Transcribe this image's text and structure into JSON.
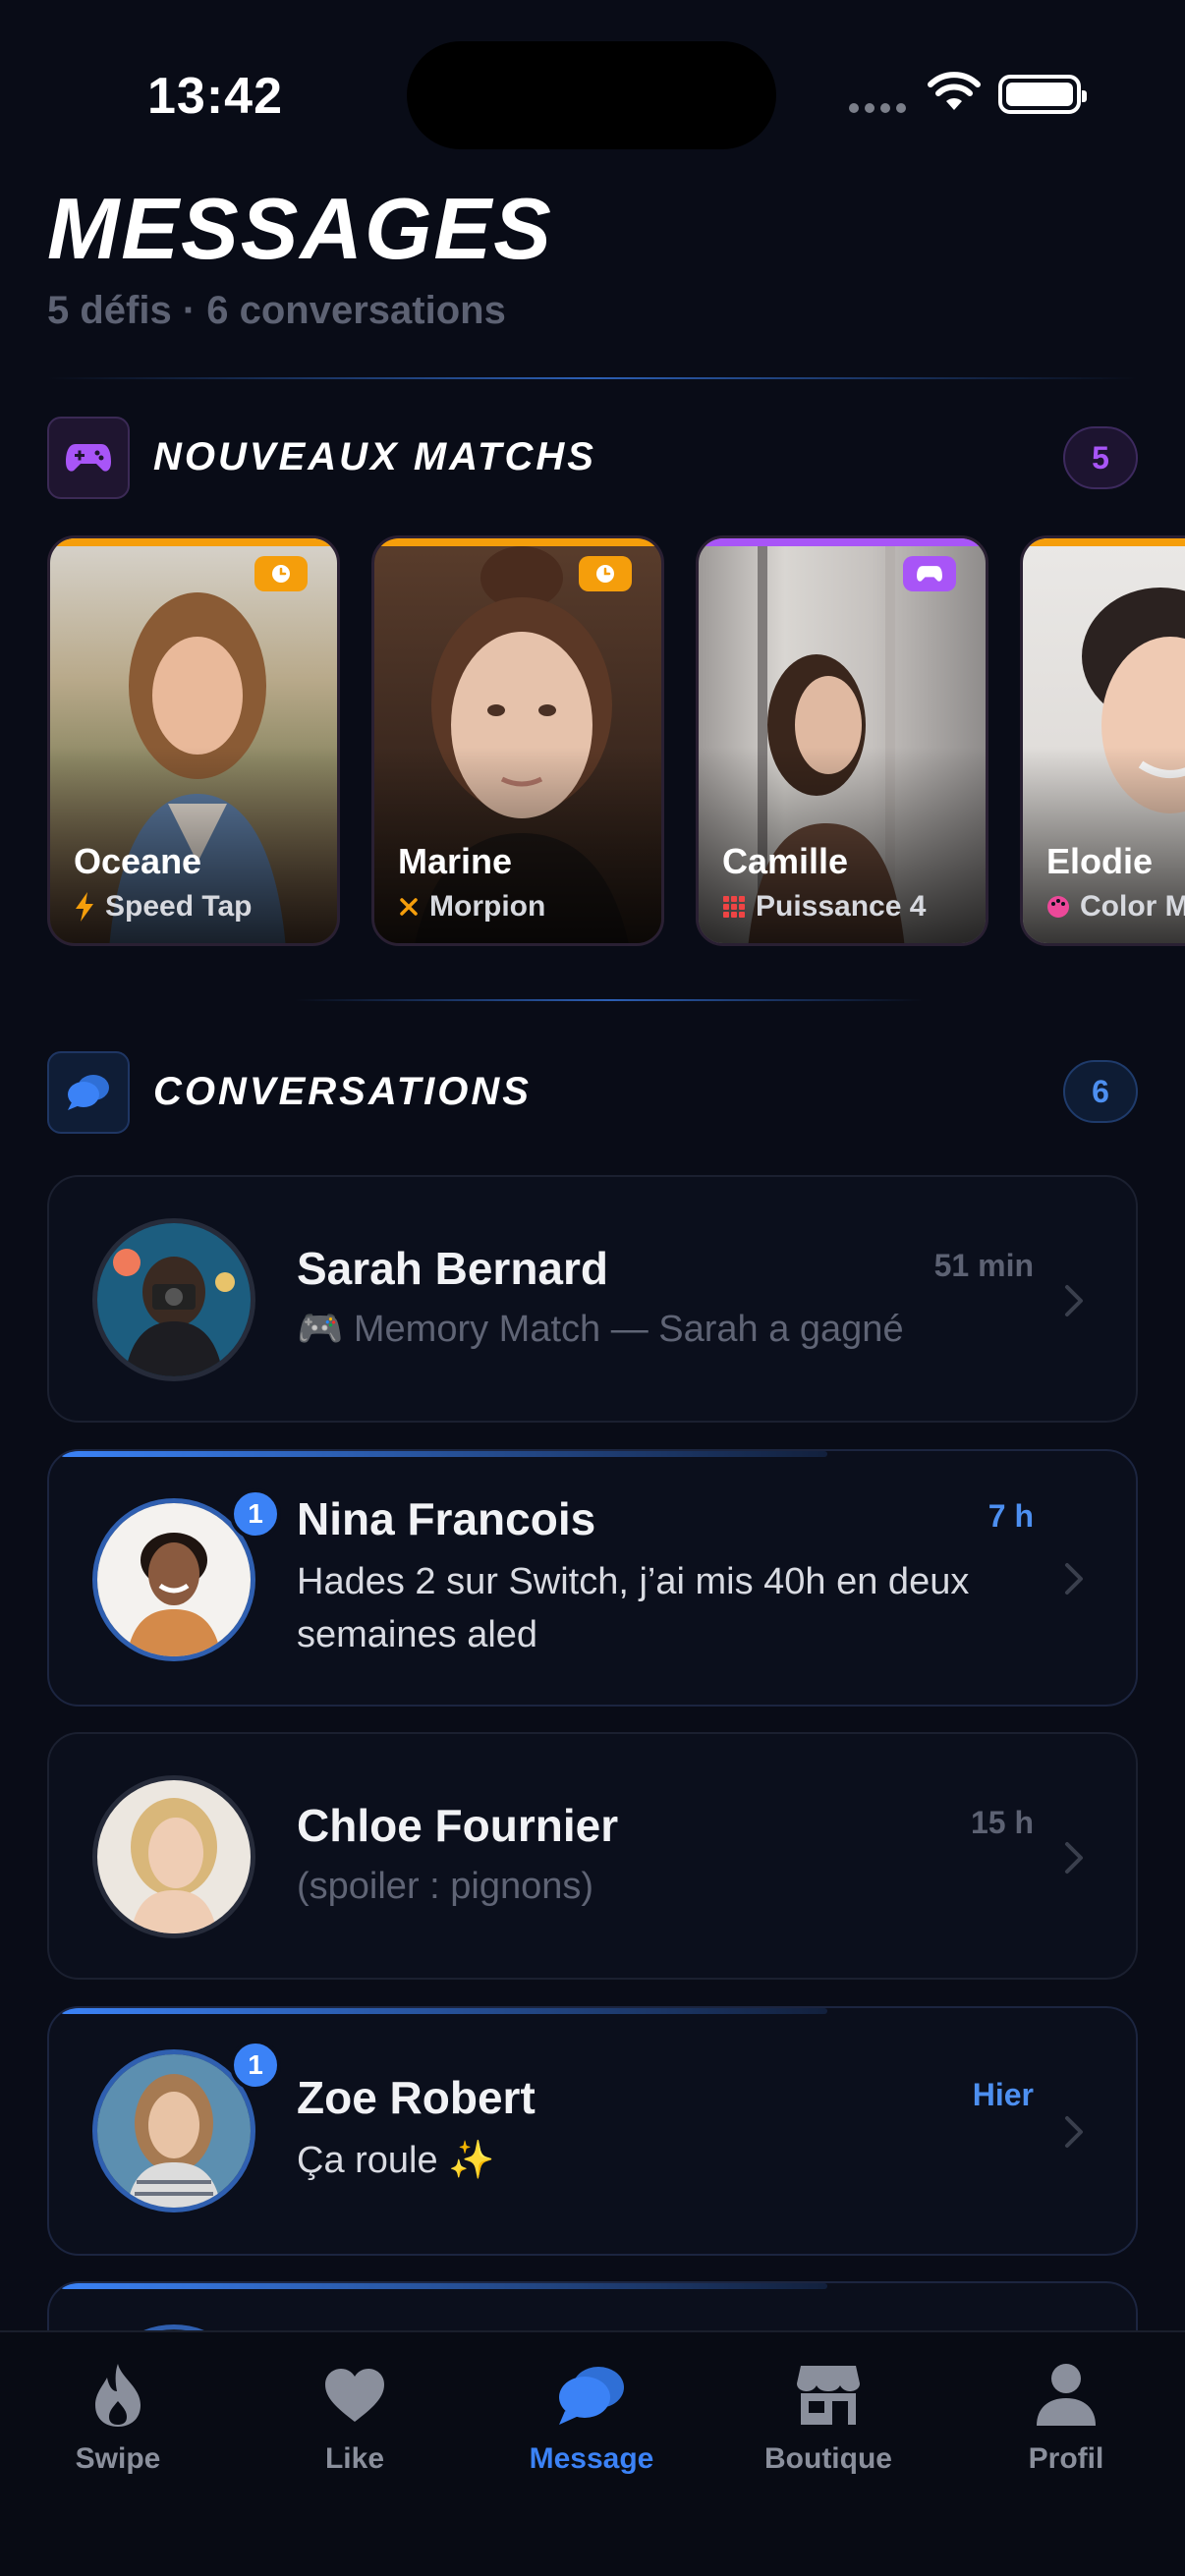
{
  "status_bar": {
    "time": "13:42"
  },
  "header": {
    "title": "MESSAGES",
    "subtitle": "5 défis · 6 conversations"
  },
  "new_matches": {
    "title": "NOUVEAUX MATCHS",
    "count": "5",
    "icon": "gamepad-icon",
    "accent_color": "#a855f7",
    "items": [
      {
        "name": "Oceane",
        "game": "Speed Tap",
        "game_icon": "lightning-icon",
        "badge_icon": "clock-icon",
        "badge_color": "#f59e0b"
      },
      {
        "name": "Marine",
        "game": "Morpion",
        "game_icon": "x-mark-icon",
        "badge_icon": "clock-icon",
        "badge_color": "#f59e0b"
      },
      {
        "name": "Camille",
        "game": "Puissance 4",
        "game_icon": "grid-dots-icon",
        "badge_icon": "gamepad-icon",
        "badge_color": "#a855f7"
      },
      {
        "name": "Elodie",
        "game": "Color M",
        "game_icon": "palette-icon",
        "badge_icon": "",
        "badge_color": ""
      }
    ]
  },
  "conversations": {
    "title": "CONVERSATIONS",
    "count": "6",
    "icon": "chat-bubbles-icon",
    "accent_color": "#3b82f6",
    "items": [
      {
        "name": "Sarah Bernard",
        "time": "51 min",
        "preview": "🎮 Memory Match — Sarah a gagné",
        "unread": "",
        "is_unread": false
      },
      {
        "name": "Nina Francois",
        "time": "7 h",
        "preview": "Hades 2 sur Switch, j’ai mis 40h en deux semaines aled",
        "unread": "1",
        "is_unread": true
      },
      {
        "name": "Chloe Fournier",
        "time": "15 h",
        "preview": "(spoiler : pignons)",
        "unread": "",
        "is_unread": false
      },
      {
        "name": "Zoe Robert",
        "time": "Hier",
        "preview": "Ça roule ✨",
        "unread": "1",
        "is_unread": true
      }
    ]
  },
  "bottom_nav": {
    "items": [
      {
        "label": "Swipe",
        "icon": "flame-icon",
        "active": false
      },
      {
        "label": "Like",
        "icon": "heart-icon",
        "active": false
      },
      {
        "label": "Message",
        "icon": "chat-bubbles-icon",
        "active": true
      },
      {
        "label": "Boutique",
        "icon": "store-icon",
        "active": false
      },
      {
        "label": "Profil",
        "icon": "person-icon",
        "active": false
      }
    ]
  },
  "colors": {
    "background": "#090c17",
    "accent_blue": "#3b82f6",
    "accent_purple": "#a855f7",
    "accent_orange": "#f59e0b"
  }
}
